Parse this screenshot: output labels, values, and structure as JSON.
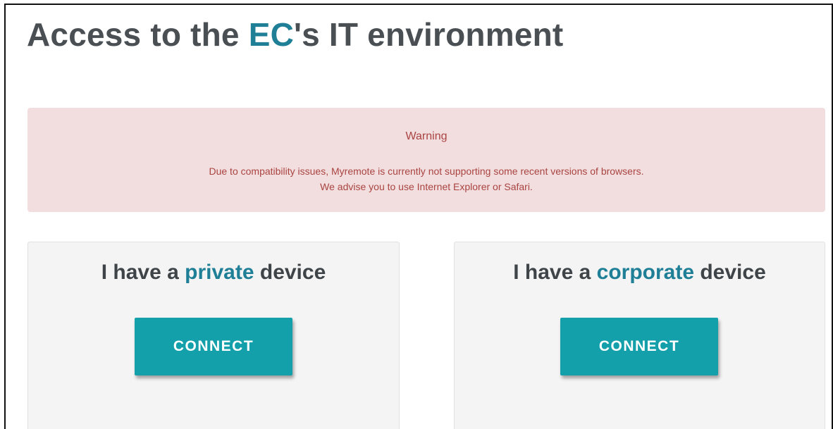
{
  "header": {
    "title_prefix": "Access to the ",
    "title_accent": "EC",
    "title_suffix": "'s IT environment"
  },
  "warning": {
    "title": "Warning",
    "line1": "Due to compatibility issues, Myremote is currently not supporting some recent versions of browsers.",
    "line2": "We advise you to use Internet Explorer or Safari."
  },
  "private_card": {
    "title_prefix": "I have a ",
    "title_accent": "private",
    "title_suffix": " device",
    "button_label": "CONNECT"
  },
  "corporate_card": {
    "title_prefix": "I have a ",
    "title_accent": "corporate",
    "title_suffix": " device",
    "button_label": "CONNECT"
  },
  "colors": {
    "accent_text": "#1f7f96",
    "title_text": "#4a4f54",
    "warning_bg": "#f2dede",
    "warning_text": "#a94442",
    "button_bg": "#13a0aa",
    "card_bg": "#f4f4f4"
  }
}
